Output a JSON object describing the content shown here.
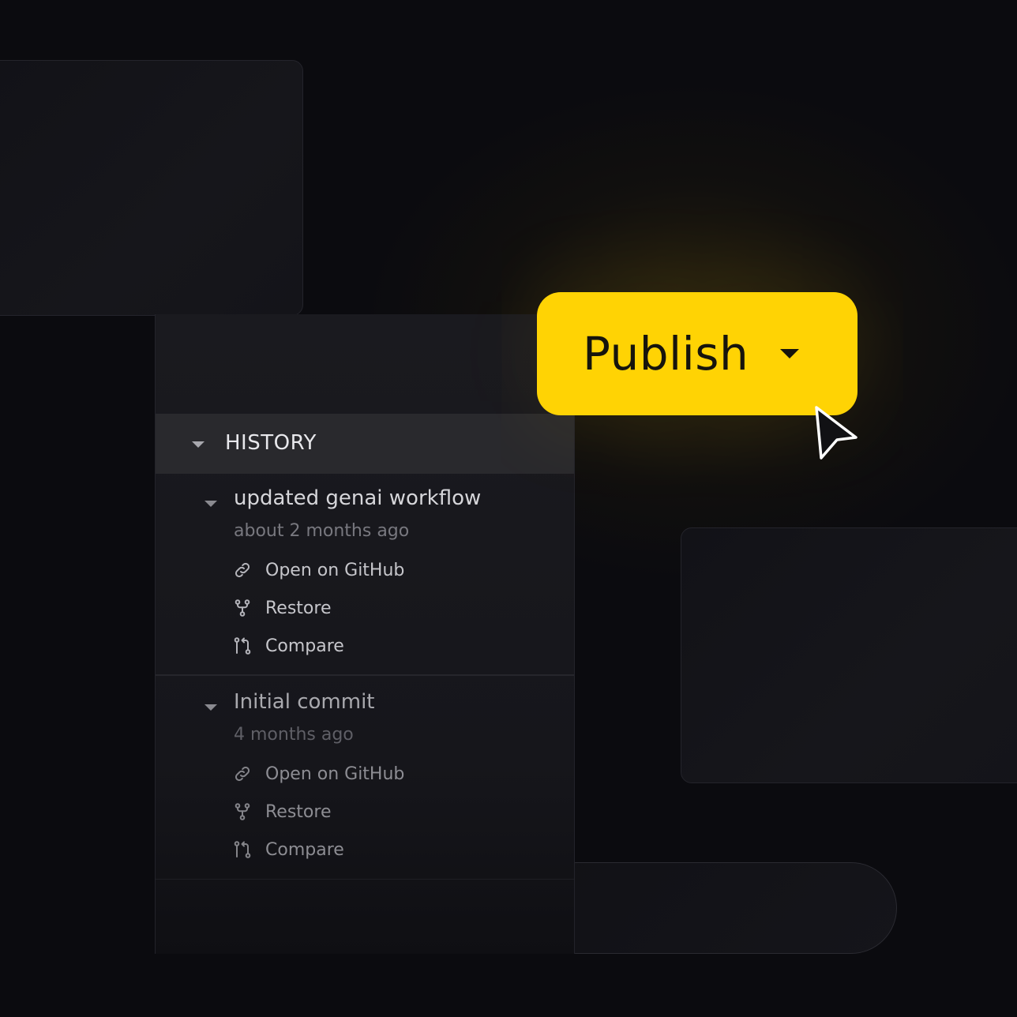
{
  "history": {
    "header_label": "HISTORY",
    "commits": [
      {
        "title": "updated genai workflow",
        "time": "about 2 months ago",
        "actions": [
          {
            "label": "Open on GitHub",
            "icon": "link-icon"
          },
          {
            "label": "Restore",
            "icon": "branch-icon"
          },
          {
            "label": "Compare",
            "icon": "compare-icon"
          }
        ]
      },
      {
        "title": "Initial commit",
        "time": "4 months ago",
        "actions": [
          {
            "label": "Open on GitHub",
            "icon": "link-icon"
          },
          {
            "label": "Restore",
            "icon": "branch-icon"
          },
          {
            "label": "Compare",
            "icon": "compare-icon"
          }
        ]
      }
    ]
  },
  "publish": {
    "label": "Publish"
  },
  "colors": {
    "accent": "#ffd304",
    "background": "#0b0b0f",
    "panel": "#1a1a1f",
    "panel_header": "#29292d"
  }
}
